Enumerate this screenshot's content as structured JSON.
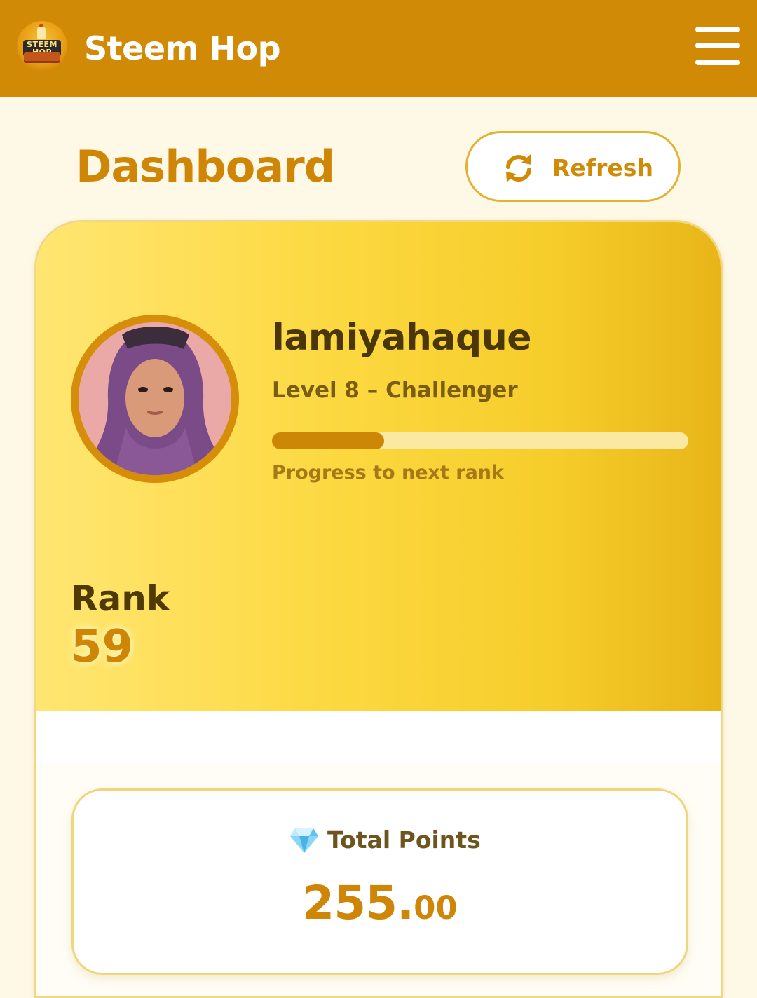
{
  "app": {
    "title": "Steem Hop",
    "logo_text": "STEEM HOP",
    "colors": {
      "header": "#d18a06",
      "accent": "#cf8607",
      "page_background": "#fef8e7"
    }
  },
  "header": {
    "menu_icon": "hamburger-menu-icon"
  },
  "dashboard": {
    "title": "Dashboard",
    "refresh_label": "Refresh",
    "refresh_icon": "refresh-icon"
  },
  "profile": {
    "username": "lamiyahaque",
    "level_text": "Level 8 – Challenger",
    "progress_fraction": 0.27,
    "progress_label": "Progress to next rank"
  },
  "rank": {
    "label": "Rank",
    "value": "59"
  },
  "points": {
    "icon": "diamond-icon",
    "label": "Total Points",
    "value_int": "255.",
    "value_dec": "00"
  }
}
